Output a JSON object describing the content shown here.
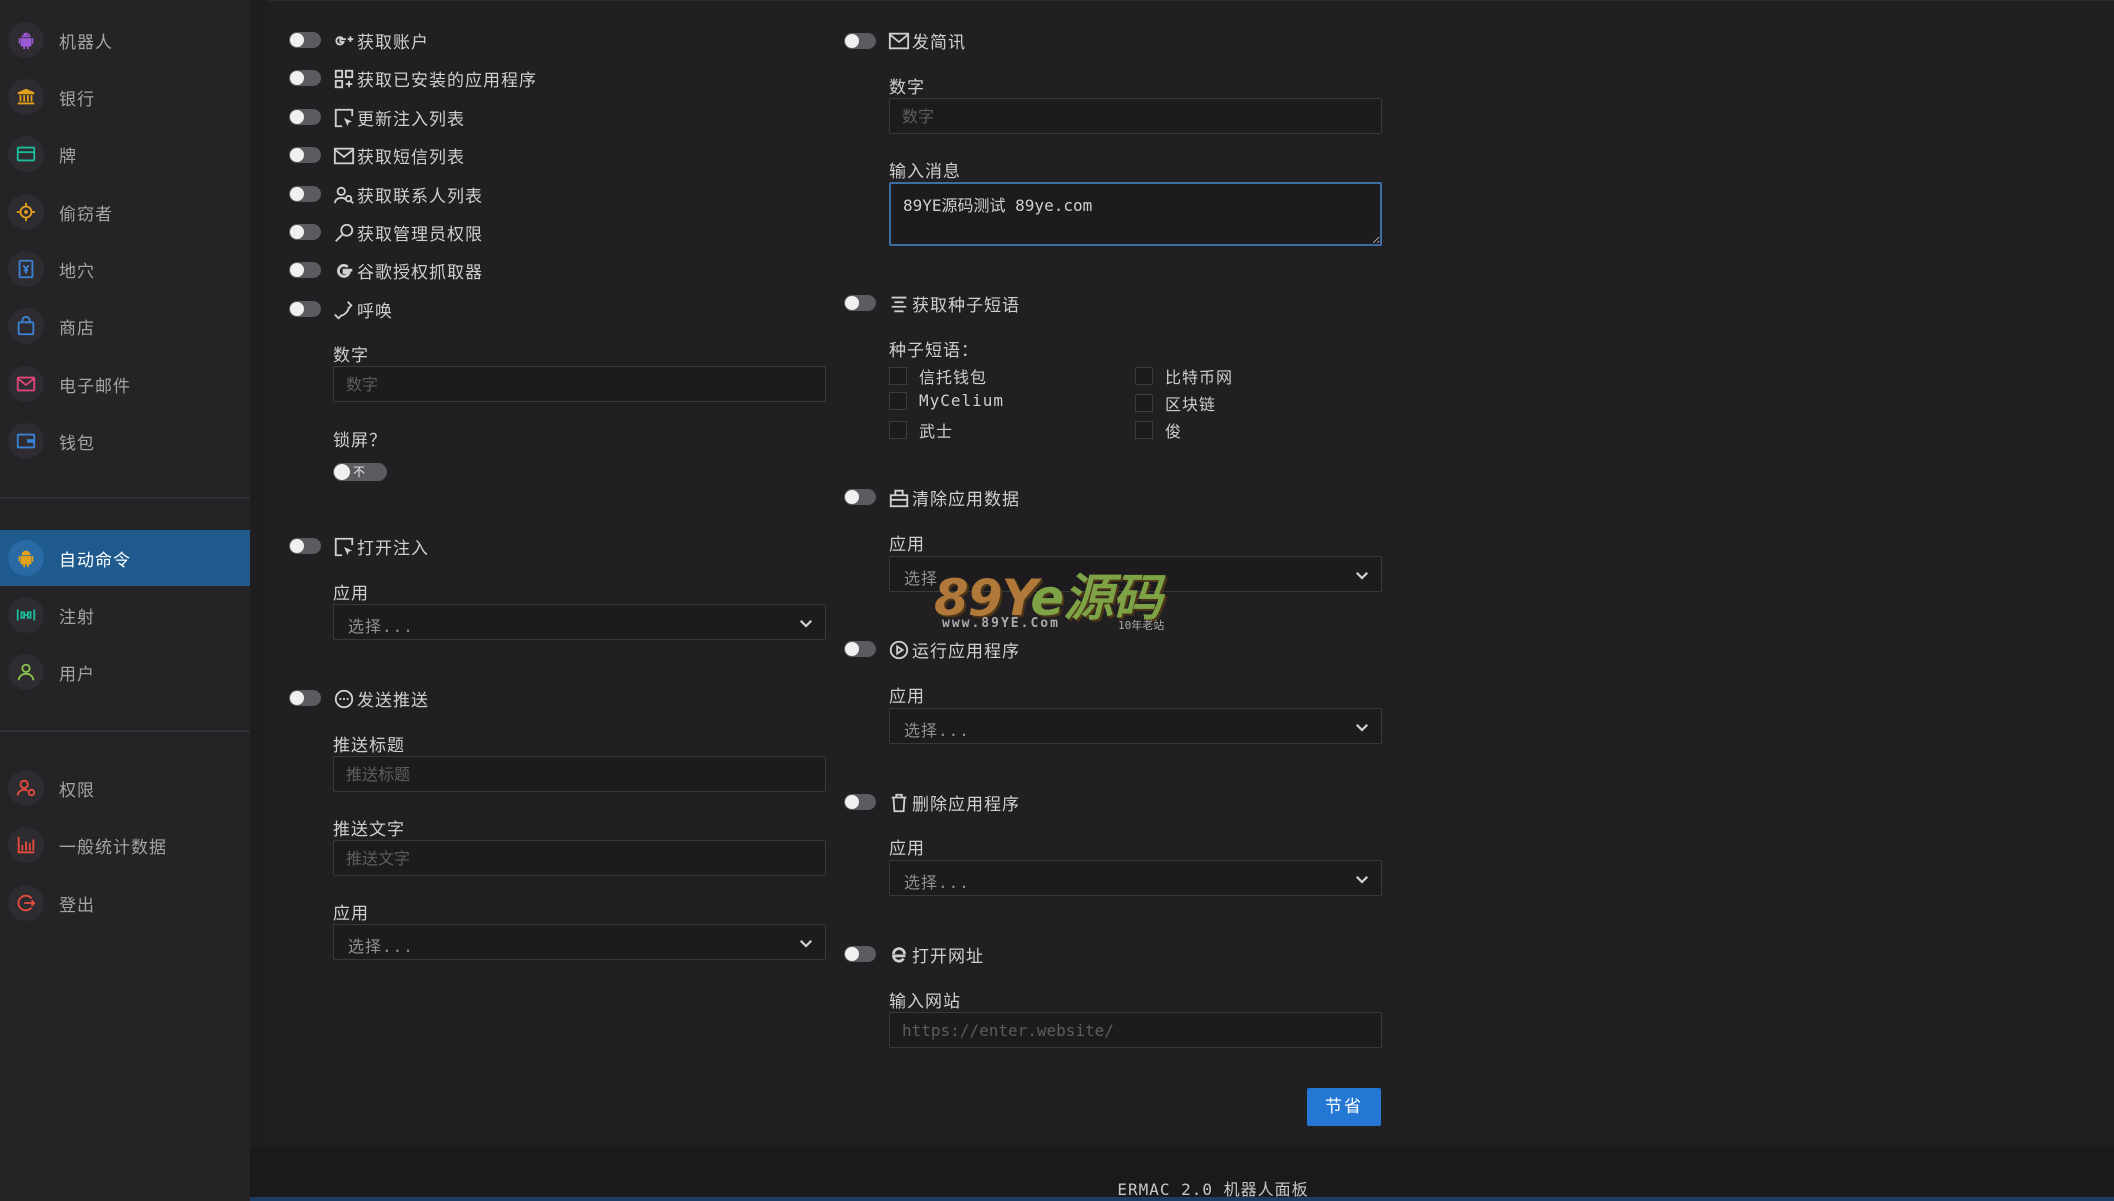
{
  "sidebar": {
    "items": [
      {
        "label": "机器人",
        "icon": "android-icon",
        "color": "#9b59d6"
      },
      {
        "label": "银行",
        "icon": "bank-icon",
        "color": "#e3a21b"
      },
      {
        "label": "牌",
        "icon": "card-icon",
        "color": "#1abc9c"
      },
      {
        "label": "偷窃者",
        "icon": "target-icon",
        "color": "#e3a21b"
      },
      {
        "label": "地穴",
        "icon": "vault-icon",
        "color": "#3b82d6"
      },
      {
        "label": "商店",
        "icon": "bag-icon",
        "color": "#3b82d6"
      },
      {
        "label": "电子邮件",
        "icon": "mail-icon",
        "color": "#e0457a"
      },
      {
        "label": "钱包",
        "icon": "wallet-icon",
        "color": "#3b82d6"
      },
      {
        "label": "自动命令",
        "icon": "android-icon",
        "color": "#e3a21b"
      },
      {
        "label": "注射",
        "icon": "syringe-icon",
        "color": "#1abc9c"
      },
      {
        "label": "用户",
        "icon": "user-icon",
        "color": "#8bc34a"
      },
      {
        "label": "权限",
        "icon": "users-cog-icon",
        "color": "#e74c3c"
      },
      {
        "label": "一般统计数据",
        "icon": "bar-chart-icon",
        "color": "#e74c3c"
      },
      {
        "label": "登出",
        "icon": "logout-icon",
        "color": "#e74c3c"
      }
    ],
    "active_index": 8
  },
  "left": {
    "options": [
      {
        "label": "获取账户",
        "icon": "google-plus-icon"
      },
      {
        "label": "获取已安装的应用程序",
        "icon": "apps-icon"
      },
      {
        "label": "更新注入列表",
        "icon": "cursor-box-icon"
      },
      {
        "label": "获取短信列表",
        "icon": "envelope-icon"
      },
      {
        "label": "获取联系人列表",
        "icon": "contacts-icon"
      },
      {
        "label": "获取管理员权限",
        "icon": "key-icon"
      },
      {
        "label": "谷歌授权抓取器",
        "icon": "google-icon"
      },
      {
        "label": "呼唤",
        "icon": "phone-icon"
      }
    ],
    "call": {
      "number_label": "数字",
      "number_placeholder": "数字",
      "lock_label": "锁屏？",
      "lock_toggle_text": "不"
    },
    "open_inject": {
      "label": "打开注入",
      "app_label": "应用",
      "app_select": "选择..."
    },
    "push": {
      "label": "发送推送",
      "title_label": "推送标题",
      "title_placeholder": "推送标题",
      "text_label": "推送文字",
      "text_placeholder": "推送文字",
      "app_label": "应用",
      "app_select": "选择..."
    }
  },
  "right": {
    "sms": {
      "label": "发简讯",
      "number_label": "数字",
      "number_placeholder": "数字",
      "message_label": "输入消息",
      "message_value": "89YE源码测试 89ye.com"
    },
    "seed": {
      "label": "获取种子短语",
      "list_label": "种子短语：",
      "items": [
        "信托钱包",
        "比特币网",
        "MyCelium",
        "区块链",
        "武士",
        "俊"
      ]
    },
    "clear_data": {
      "label": "清除应用数据",
      "app_label": "应用",
      "app_select": "选择..."
    },
    "run_app": {
      "label": "运行应用程序",
      "app_label": "应用",
      "app_select": "选择..."
    },
    "delete_app": {
      "label": "删除应用程序",
      "app_label": "应用",
      "app_select": "选择..."
    },
    "open_url": {
      "label": "打开网址",
      "url_label": "输入网站",
      "url_placeholder": "https://enter.website/"
    }
  },
  "save_label": "节省",
  "footer": "ERMAC 2.0 机器人面板",
  "watermark": {
    "main_a": "89Y",
    "main_b": "e源码",
    "url": "www.89YE.Com",
    "tag": "10年老站"
  },
  "colors": {
    "active_bg": "#1f5a8f",
    "accent_blue": "#2477d3",
    "panel_bg": "#211f22"
  }
}
